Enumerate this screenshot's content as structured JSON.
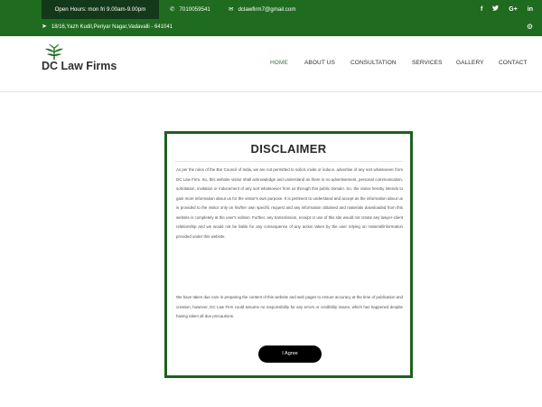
{
  "topbar": {
    "hours": "Open Hours: mon fri 9.00am-9.00pm",
    "phone": "7010059541",
    "email": "dclawfirm7@gmail.com",
    "address": "18/16,Yazh Kudil,Periyar Nagar,Vadavalli - 641041",
    "socials": [
      "f",
      "t",
      "G+",
      "in"
    ],
    "icons": {
      "phone": "phone-icon",
      "email": "email-icon",
      "address": "location-arrow-icon",
      "gear": "gear-icon"
    },
    "colors": {
      "bar": "#1f6b1f",
      "hours_bg": "#14391a"
    }
  },
  "header": {
    "logo_text": "DC Law Firms",
    "nav": [
      "HOME",
      "ABOUT US",
      "CONSULTATION",
      "SERVICES",
      "GALLERY",
      "CONTACT"
    ],
    "active_nav": "HOME",
    "active_color": "#2f7a2f"
  },
  "modal": {
    "title": "DISCLAIMER",
    "paragraph1": "As per the rules of the Bar Council of India, we are not permitted to solicit, invite or induce, advertise of any sort whatsoever from DC Law Firm. So, this website visitor shall acknowledge and understand as there is no advertisement, personal communication, solicitation, invitation or inducement of any sort whatsoever from us through this public domain. So, the visitor hereby intends to gain more information about us for the visitor's own purpose. It is pertinent to understand and accept as the information about us is provided to the visitor only on his/her own specific request and any information obtained and materials downloaded from this website is completely at the user's volition. Further, any transmission, receipt or use of this site would not create any lawyer-client relationship and we would not be liable for any consequence of any action taken by the user relying on material/information provided under this website.",
    "paragraph2": "We have taken due care in preparing the content of this website and web pages to ensure accuracy at the time of publication and creation, however, DC Law Firm could assume no responsibility for any errors or credibility issues, which has happened despite having taken all due precautions.",
    "agree_label": "I Agree",
    "border_color": "#1f5f1f"
  }
}
